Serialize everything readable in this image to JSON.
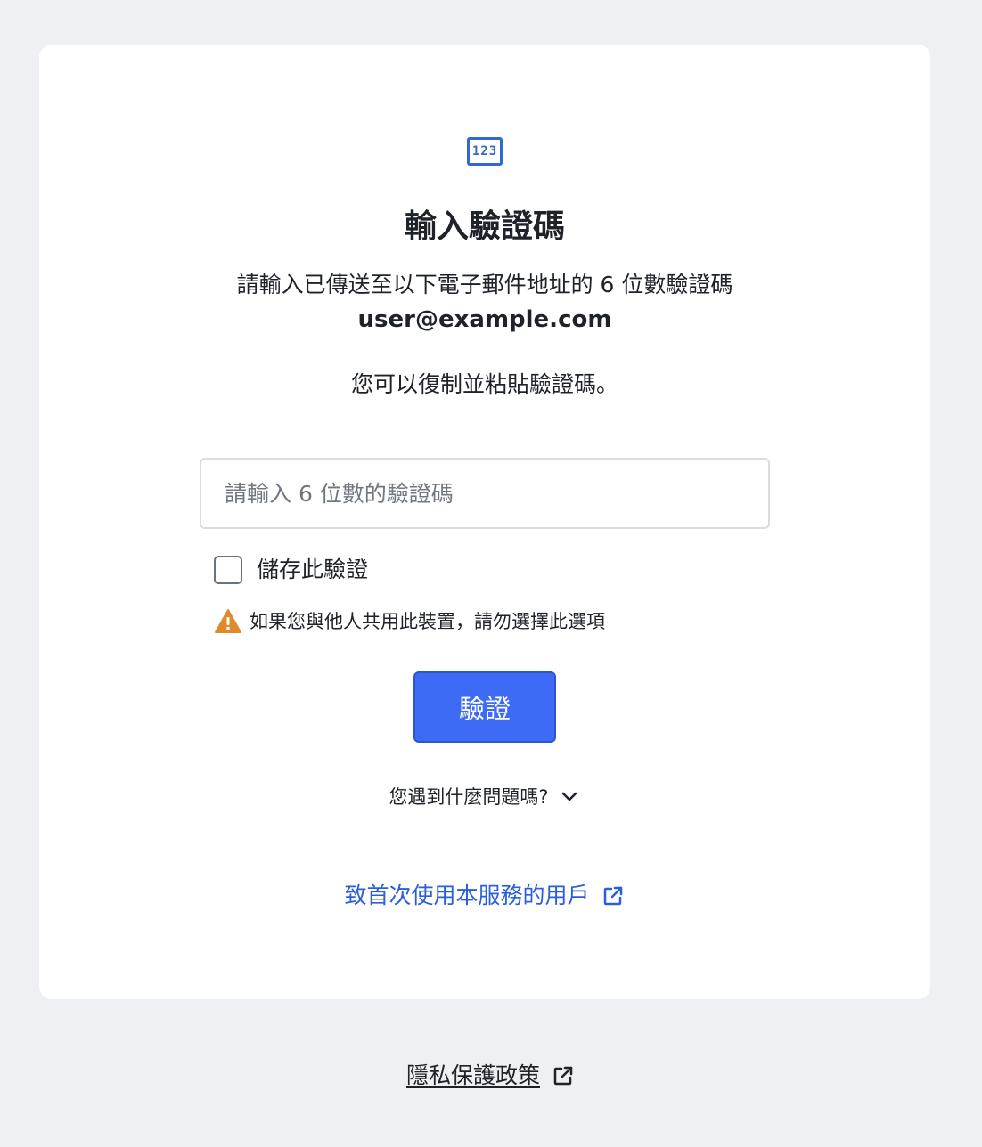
{
  "card": {
    "icon": "number-code-icon",
    "icon_text": "123",
    "title": "輸入驗證碼",
    "subtitle": "請輸入已傳送至以下電子郵件地址的 6 位數驗證碼",
    "email": "user@example.com",
    "paste_hint": "您可以復制並粘貼驗證碼。",
    "code_input": {
      "value": "",
      "placeholder": "請輸入 6 位數的驗證碼"
    },
    "save_checkbox": {
      "label": "儲存此驗證",
      "checked": false
    },
    "warning": {
      "icon": "warning-triangle-icon",
      "text": "如果您與他人共用此裝置，請勿選擇此選項"
    },
    "verify_button_label": "驗證",
    "problem_toggle": {
      "label": "您遇到什麼問題嗎?",
      "icon": "chevron-down-icon"
    },
    "first_time_link": {
      "label": "致首次使用本服務的用戶",
      "icon": "external-link-icon"
    }
  },
  "footer": {
    "privacy_link": {
      "label": "隱私保護政策",
      "icon": "external-link-icon"
    }
  },
  "colors": {
    "background": "#eef0f3",
    "card": "#ffffff",
    "accent": "#3d6bf5",
    "link": "#2b5fd9",
    "warning": "#e08a2e",
    "text": "#1f2329"
  }
}
